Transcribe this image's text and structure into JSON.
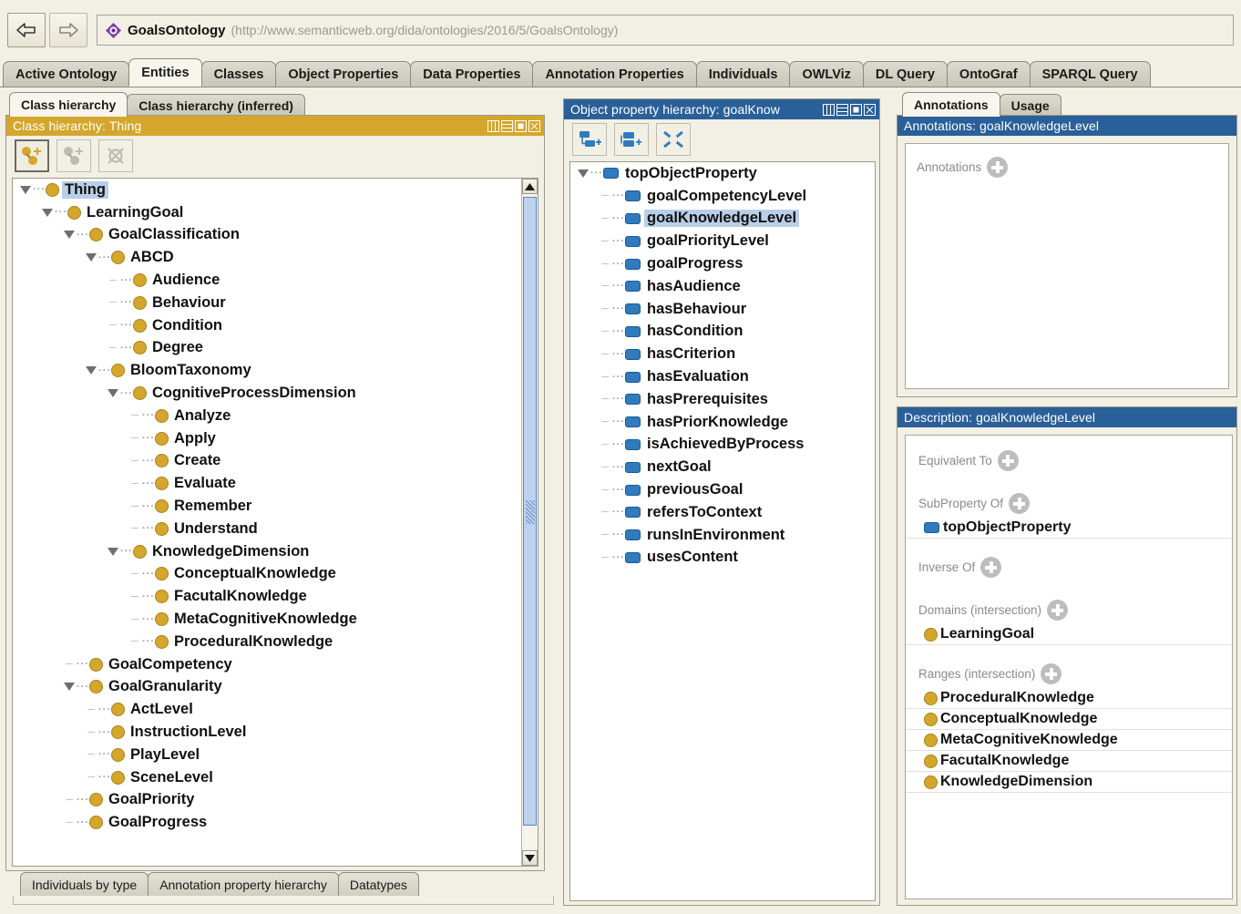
{
  "titlebar": {
    "back_icon": "arrow-left-icon",
    "forward_icon": "arrow-right-icon",
    "ontology_icon": "ontology-diamond-icon",
    "ontology_name": "GoalsOntology",
    "ontology_uri": "(http://www.semanticweb.org/dida/ontologies/2016/5/GoalsOntology)"
  },
  "tabs": [
    {
      "label": "Active Ontology",
      "active": false
    },
    {
      "label": "Entities",
      "active": true
    },
    {
      "label": "Classes",
      "active": false
    },
    {
      "label": "Object Properties",
      "active": false
    },
    {
      "label": "Data Properties",
      "active": false
    },
    {
      "label": "Annotation Properties",
      "active": false
    },
    {
      "label": "Individuals",
      "active": false
    },
    {
      "label": "OWLViz",
      "active": false
    },
    {
      "label": "DL Query",
      "active": false
    },
    {
      "label": "OntoGraf",
      "active": false
    },
    {
      "label": "SPARQL Query",
      "active": false
    }
  ],
  "class_panel": {
    "subtabs": [
      {
        "label": "Class hierarchy",
        "active": true
      },
      {
        "label": "Class hierarchy (inferred)",
        "active": false
      }
    ],
    "header": "Class hierarchy: Thing",
    "header_color": "#d4a72c",
    "window_controls": [
      "split-icon",
      "minimize-icon",
      "maximize-icon",
      "close-icon"
    ],
    "toolbar": [
      {
        "name": "add-subclass-button",
        "enabled": true
      },
      {
        "name": "add-sibling-class-button",
        "enabled": false
      },
      {
        "name": "delete-class-button",
        "enabled": false
      }
    ],
    "tree": [
      {
        "label": "Thing",
        "depth": 0,
        "twisty": "open",
        "selected": true
      },
      {
        "label": "LearningGoal",
        "depth": 1,
        "twisty": "open",
        "selected": false
      },
      {
        "label": "GoalClassification",
        "depth": 2,
        "twisty": "open",
        "selected": false
      },
      {
        "label": "ABCD",
        "depth": 3,
        "twisty": "open",
        "selected": false
      },
      {
        "label": "Audience",
        "depth": 4,
        "twisty": "leaf",
        "selected": false
      },
      {
        "label": "Behaviour",
        "depth": 4,
        "twisty": "leaf",
        "selected": false
      },
      {
        "label": "Condition",
        "depth": 4,
        "twisty": "leaf",
        "selected": false
      },
      {
        "label": "Degree",
        "depth": 4,
        "twisty": "leaf",
        "selected": false
      },
      {
        "label": "BloomTaxonomy",
        "depth": 3,
        "twisty": "open",
        "selected": false
      },
      {
        "label": "CognitiveProcessDimension",
        "depth": 4,
        "twisty": "open",
        "selected": false
      },
      {
        "label": "Analyze",
        "depth": 5,
        "twisty": "leaf",
        "selected": false
      },
      {
        "label": "Apply",
        "depth": 5,
        "twisty": "leaf",
        "selected": false
      },
      {
        "label": "Create",
        "depth": 5,
        "twisty": "leaf",
        "selected": false
      },
      {
        "label": "Evaluate",
        "depth": 5,
        "twisty": "leaf",
        "selected": false
      },
      {
        "label": "Remember",
        "depth": 5,
        "twisty": "leaf",
        "selected": false
      },
      {
        "label": "Understand",
        "depth": 5,
        "twisty": "leaf",
        "selected": false
      },
      {
        "label": "KnowledgeDimension",
        "depth": 4,
        "twisty": "open",
        "selected": false
      },
      {
        "label": "ConceptualKnowledge",
        "depth": 5,
        "twisty": "leaf",
        "selected": false
      },
      {
        "label": "FacutalKnowledge",
        "depth": 5,
        "twisty": "leaf",
        "selected": false
      },
      {
        "label": "MetaCognitiveKnowledge",
        "depth": 5,
        "twisty": "leaf",
        "selected": false
      },
      {
        "label": "ProceduralKnowledge",
        "depth": 5,
        "twisty": "leaf",
        "selected": false
      },
      {
        "label": "GoalCompetency",
        "depth": 2,
        "twisty": "leaf",
        "selected": false
      },
      {
        "label": "GoalGranularity",
        "depth": 2,
        "twisty": "open",
        "selected": false
      },
      {
        "label": "ActLevel",
        "depth": 3,
        "twisty": "leaf",
        "selected": false
      },
      {
        "label": "InstructionLevel",
        "depth": 3,
        "twisty": "leaf",
        "selected": false
      },
      {
        "label": "PlayLevel",
        "depth": 3,
        "twisty": "leaf",
        "selected": false
      },
      {
        "label": "SceneLevel",
        "depth": 3,
        "twisty": "leaf",
        "selected": false
      },
      {
        "label": "GoalPriority",
        "depth": 2,
        "twisty": "leaf",
        "selected": false
      },
      {
        "label": "GoalProgress",
        "depth": 2,
        "twisty": "leaf",
        "selected": false
      }
    ]
  },
  "bottom_tabs": [
    {
      "label": "Individuals by type"
    },
    {
      "label": "Annotation property hierarchy"
    },
    {
      "label": "Datatypes"
    }
  ],
  "object_panel": {
    "header": "Object property hierarchy: goalKnow",
    "header_color": "#2a6099",
    "window_controls": [
      "split-icon",
      "minimize-icon",
      "maximize-icon",
      "close-icon"
    ],
    "toolbar": [
      {
        "name": "add-sub-property-button"
      },
      {
        "name": "add-sibling-property-button"
      },
      {
        "name": "delete-property-button"
      }
    ],
    "tree": [
      {
        "label": "topObjectProperty",
        "depth": 0,
        "twisty": "open",
        "selected": false
      },
      {
        "label": "goalCompetencyLevel",
        "depth": 1,
        "twisty": "leaf",
        "selected": false
      },
      {
        "label": "goalKnowledgeLevel",
        "depth": 1,
        "twisty": "leaf",
        "selected": true
      },
      {
        "label": "goalPriorityLevel",
        "depth": 1,
        "twisty": "leaf",
        "selected": false
      },
      {
        "label": "goalProgress",
        "depth": 1,
        "twisty": "leaf",
        "selected": false
      },
      {
        "label": "hasAudience",
        "depth": 1,
        "twisty": "leaf",
        "selected": false
      },
      {
        "label": "hasBehaviour",
        "depth": 1,
        "twisty": "leaf",
        "selected": false
      },
      {
        "label": "hasCondition",
        "depth": 1,
        "twisty": "leaf",
        "selected": false
      },
      {
        "label": "hasCriterion",
        "depth": 1,
        "twisty": "leaf",
        "selected": false
      },
      {
        "label": "hasEvaluation",
        "depth": 1,
        "twisty": "leaf",
        "selected": false
      },
      {
        "label": "hasPrerequisites",
        "depth": 1,
        "twisty": "leaf",
        "selected": false
      },
      {
        "label": "hasPriorKnowledge",
        "depth": 1,
        "twisty": "leaf",
        "selected": false
      },
      {
        "label": "isAchievedByProcess",
        "depth": 1,
        "twisty": "leaf",
        "selected": false
      },
      {
        "label": "nextGoal",
        "depth": 1,
        "twisty": "leaf",
        "selected": false
      },
      {
        "label": "previousGoal",
        "depth": 1,
        "twisty": "leaf",
        "selected": false
      },
      {
        "label": "refersToContext",
        "depth": 1,
        "twisty": "leaf",
        "selected": false
      },
      {
        "label": "runsInEnvironment",
        "depth": 1,
        "twisty": "leaf",
        "selected": false
      },
      {
        "label": "usesContent",
        "depth": 1,
        "twisty": "leaf",
        "selected": false
      }
    ]
  },
  "annotations_panel": {
    "subtabs": [
      {
        "label": "Annotations",
        "active": true
      },
      {
        "label": "Usage",
        "active": false
      }
    ],
    "header": "Annotations: goalKnowledgeLevel",
    "header_color": "#2a6099",
    "section_label": "Annotations",
    "add_icon": "plus-circle-icon"
  },
  "description_panel": {
    "header": "Description: goalKnowledgeLevel",
    "header_color": "#2a6099",
    "sections": [
      {
        "label": "Equivalent To",
        "items": []
      },
      {
        "label": "SubProperty Of",
        "items": [
          {
            "text": "topObjectProperty",
            "icon": "object-property-icon"
          }
        ]
      },
      {
        "label": "Inverse Of",
        "items": []
      },
      {
        "label": "Domains (intersection)",
        "items": [
          {
            "text": "LearningGoal",
            "icon": "class-icon"
          }
        ]
      },
      {
        "label": "Ranges (intersection)",
        "items": [
          {
            "text": "ProceduralKnowledge",
            "icon": "class-icon"
          },
          {
            "text": "ConceptualKnowledge",
            "icon": "class-icon"
          },
          {
            "text": "MetaCognitiveKnowledge",
            "icon": "class-icon"
          },
          {
            "text": "FacutalKnowledge",
            "icon": "class-icon"
          },
          {
            "text": "KnowledgeDimension",
            "icon": "class-icon"
          }
        ]
      }
    ]
  },
  "colors": {
    "gold": "#d4a72c",
    "blue": "#2a6099",
    "selection": "#b9cfe8",
    "panel_bg": "#f2efe4"
  }
}
